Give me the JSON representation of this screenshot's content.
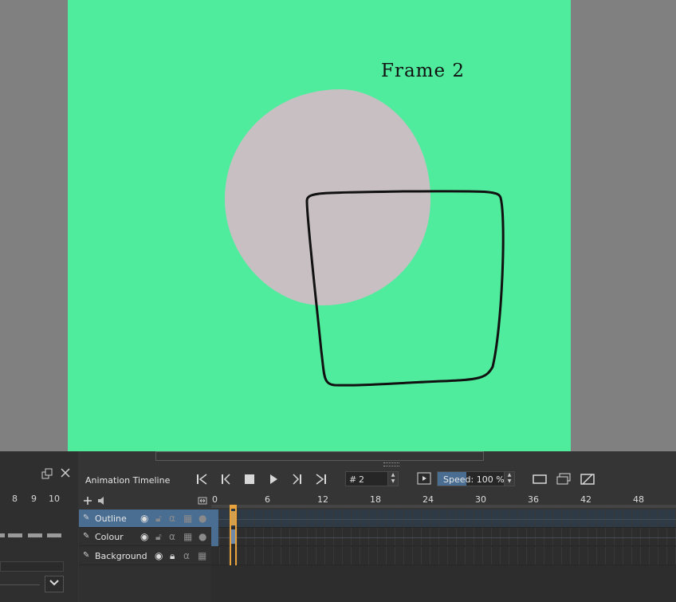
{
  "canvas": {
    "background_color": "#50ec9e",
    "frame_text": "Frame 2",
    "circle_color": "#c8bfc2",
    "outline_color": "#111111"
  },
  "left_panel": {
    "numbers": [
      "8",
      "9",
      "10"
    ],
    "float_icon": "float-window-icon",
    "close_icon": "close-icon",
    "dropdown_icon": "chevron-down-icon"
  },
  "timeline": {
    "title": "Animation Timeline",
    "transport": {
      "first": "first-frame-icon",
      "prev_keyframe": "previous-keyframe-icon",
      "stop": "stop-icon",
      "play": "play-icon",
      "next_keyframe": "next-keyframe-icon",
      "last": "last-frame-icon"
    },
    "frame_prefix": "#",
    "current_frame": "2",
    "speed_label": "Speed:",
    "speed_value": "100 %",
    "speed_fraction": 0.37,
    "ruler_ticks": [
      "0",
      "6",
      "12",
      "18",
      "24",
      "30",
      "36",
      "42",
      "48"
    ],
    "layers": [
      {
        "name": "Outline",
        "selected": true
      },
      {
        "name": "Colour",
        "selected": false
      },
      {
        "name": "Background",
        "selected": false
      }
    ],
    "accent_color": "#4a6d92",
    "playhead_color": "#e8a33c"
  }
}
